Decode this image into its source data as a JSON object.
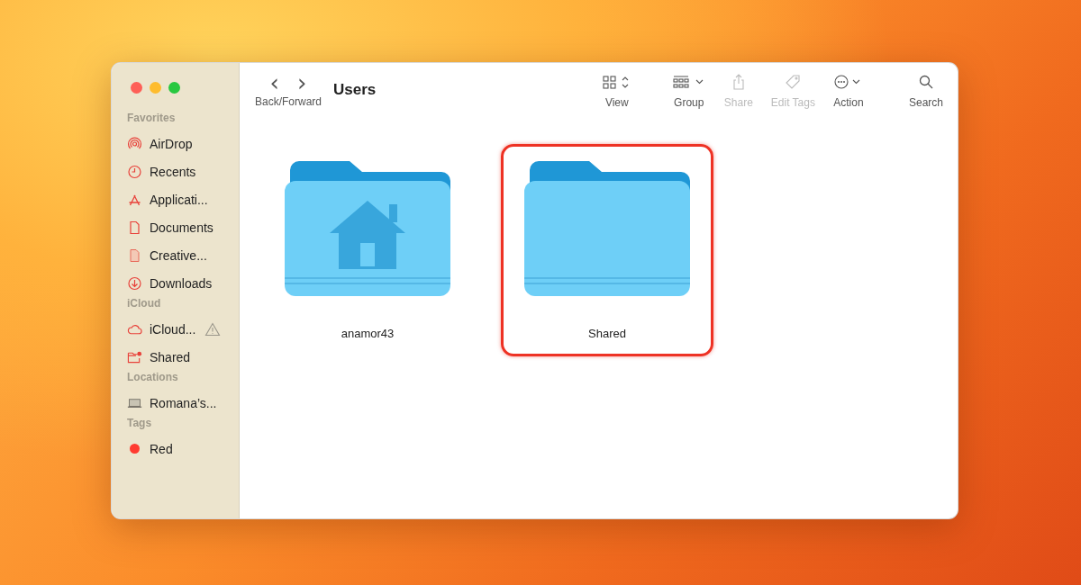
{
  "window": {
    "title": "Users"
  },
  "navigation": {
    "label": "Back/Forward",
    "back": "‹",
    "forward": "›"
  },
  "sidebar": {
    "sections": [
      {
        "heading": "Favorites",
        "items": [
          {
            "label": "AirDrop",
            "kind": "airdrop"
          },
          {
            "label": "Recents",
            "kind": "clock"
          },
          {
            "label": "Applicati...",
            "kind": "apps"
          },
          {
            "label": "Documents",
            "kind": "doc"
          },
          {
            "label": "Creative...",
            "kind": "docfill"
          },
          {
            "label": "Downloads",
            "kind": "download"
          }
        ]
      },
      {
        "heading": "iCloud",
        "items": [
          {
            "label": "iCloud...",
            "kind": "cloud",
            "warning": true
          },
          {
            "label": "Shared",
            "kind": "sharedfolder"
          }
        ]
      },
      {
        "heading": "Locations",
        "items": [
          {
            "label": "Romana’s...",
            "kind": "laptop"
          }
        ]
      },
      {
        "heading": "Tags",
        "items": [
          {
            "label": "Red",
            "kind": "tag",
            "color": "#ff3b30"
          }
        ]
      }
    ]
  },
  "toolbar": [
    {
      "label": "View",
      "kind": "view",
      "disabled": false
    },
    {
      "label": "Group",
      "kind": "group",
      "disabled": false
    },
    {
      "label": "Share",
      "kind": "share",
      "disabled": true
    },
    {
      "label": "Edit Tags",
      "kind": "tag",
      "disabled": true
    },
    {
      "label": "Action",
      "kind": "action",
      "disabled": false
    },
    {
      "label": "Search",
      "kind": "search",
      "disabled": false
    }
  ],
  "folders": [
    {
      "name": "anamor43",
      "kind": "home",
      "selected": false
    },
    {
      "name": "Shared",
      "kind": "plain",
      "selected": true
    }
  ]
}
